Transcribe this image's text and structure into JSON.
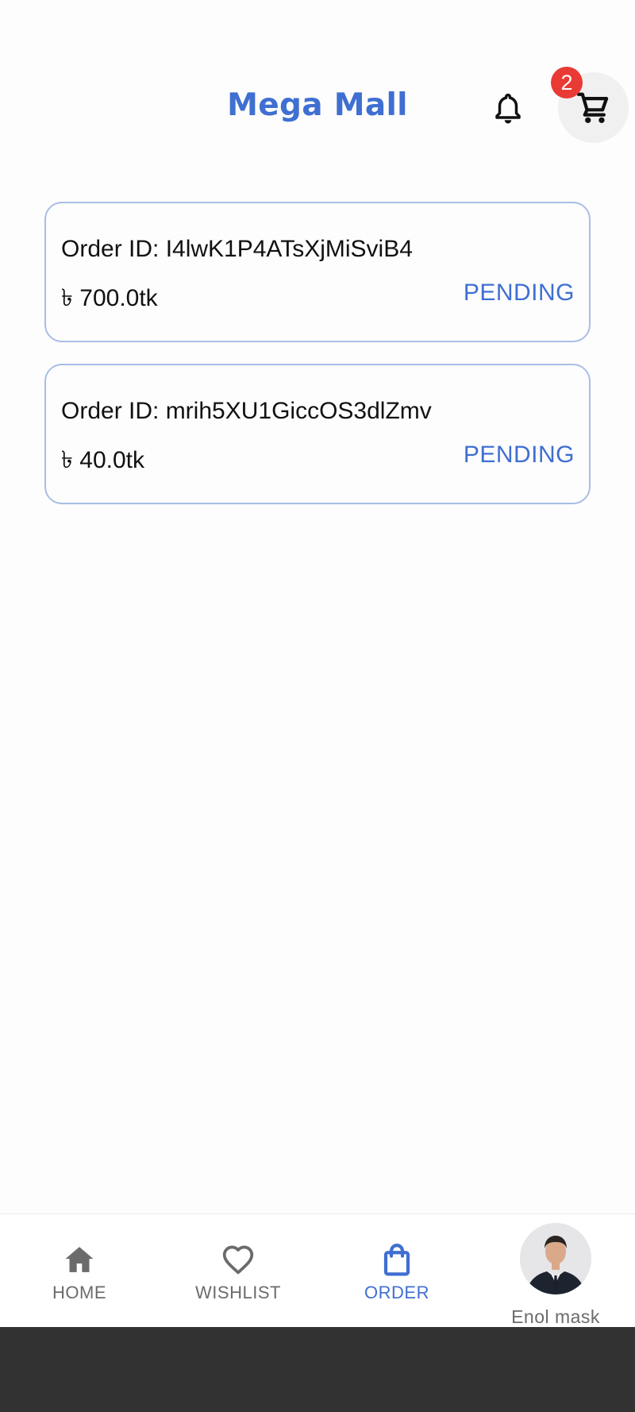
{
  "header": {
    "title": "Mega Mall",
    "cart_badge_count": "2",
    "icons": {
      "notifications": "bell-outline-icon",
      "cart": "cart-icon"
    }
  },
  "orders": [
    {
      "id_text": "Order ID: I4lwK1P4ATsXjMiSviB4",
      "price_text": "৳ 700.0tk",
      "status": "PENDING"
    },
    {
      "id_text": "Order ID: mrih5XU1GiccOS3dlZmv",
      "price_text": "৳ 40.0tk",
      "status": "PENDING"
    }
  ],
  "bottom_nav": {
    "items": [
      {
        "label": "HOME",
        "icon": "home-icon",
        "active": false
      },
      {
        "label": "WISHLIST",
        "icon": "heart-outline-icon",
        "active": false
      },
      {
        "label": "ORDER",
        "icon": "shopping-bag-icon",
        "active": true
      }
    ],
    "profile": {
      "name": "Enol mask",
      "icon": "avatar"
    }
  },
  "colors": {
    "accent": "#3f6fd1",
    "badge": "#e93a35",
    "card_border": "#a9bde6",
    "inactive_nav": "#6b6b6b",
    "system_bar": "#323232"
  }
}
